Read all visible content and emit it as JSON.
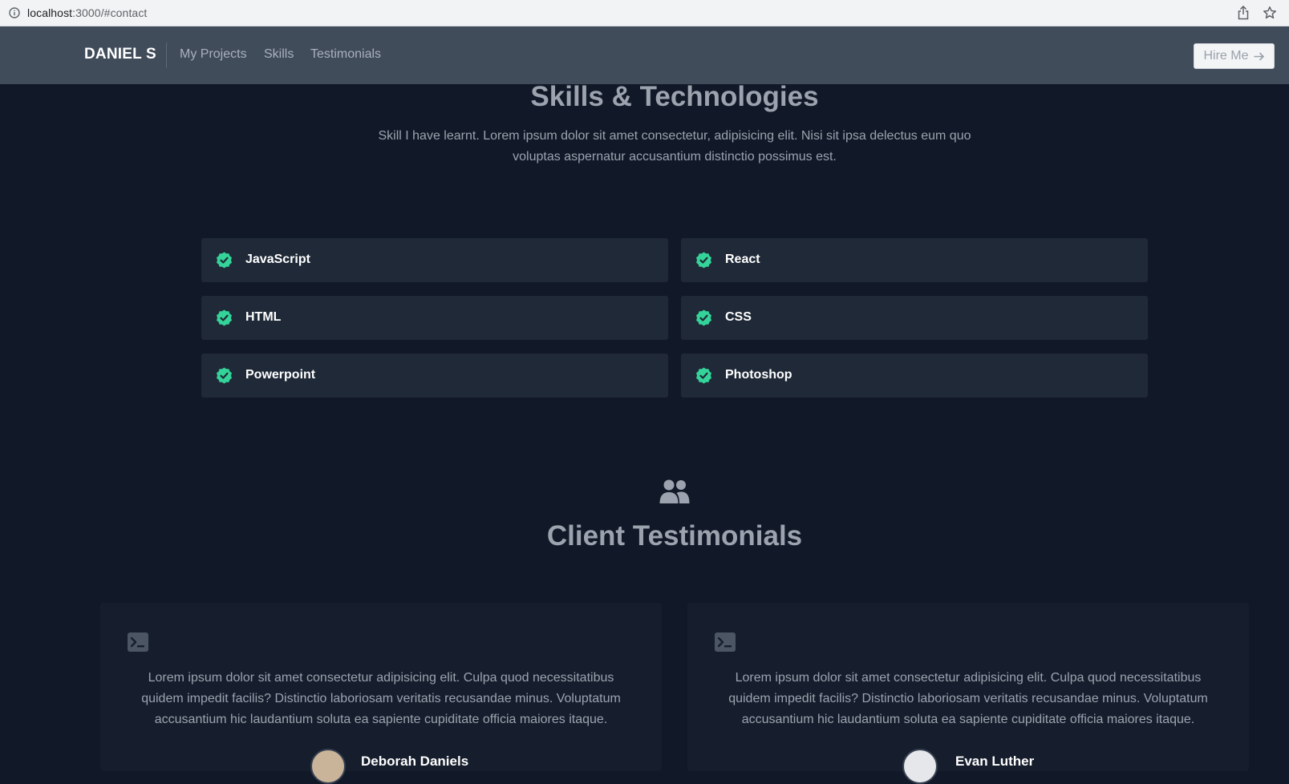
{
  "browser": {
    "url_host": "localhost",
    "url_rest": ":3000/#contact"
  },
  "navbar": {
    "brand": "DANIEL S",
    "links": [
      "My Projects",
      "Skills",
      "Testimonials"
    ],
    "cta_label": "Hire Me"
  },
  "skills": {
    "title": "Skills & Technologies",
    "description": "Skill I have learnt. Lorem ipsum dolor sit amet consectetur, adipisicing elit. Nisi sit ipsa delectus eum quo voluptas aspernatur accusantium distinctio possimus est.",
    "items": [
      "JavaScript",
      "React",
      "HTML",
      "CSS",
      "Powerpoint",
      "Photoshop"
    ],
    "check_color": "#34d399"
  },
  "testimonials": {
    "title": "Client Testimonials",
    "items": [
      {
        "text": "Lorem ipsum dolor sit amet consectetur adipisicing elit. Culpa quod necessitatibus quidem impedit facilis? Distinctio laboriosam veritatis recusandae minus. Voluptatum accusantium hic laudantium soluta ea sapiente cupiditate officia maiores itaque.",
        "author": "Deborah Daniels"
      },
      {
        "text": "Lorem ipsum dolor sit amet consectetur adipisicing elit. Culpa quod necessitatibus quidem impedit facilis? Distinctio laboriosam veritatis recusandae minus. Voluptatum accusantium hic laudantium soluta ea sapiente cupiditate officia maiores itaque.",
        "author": "Evan Luther"
      }
    ]
  }
}
